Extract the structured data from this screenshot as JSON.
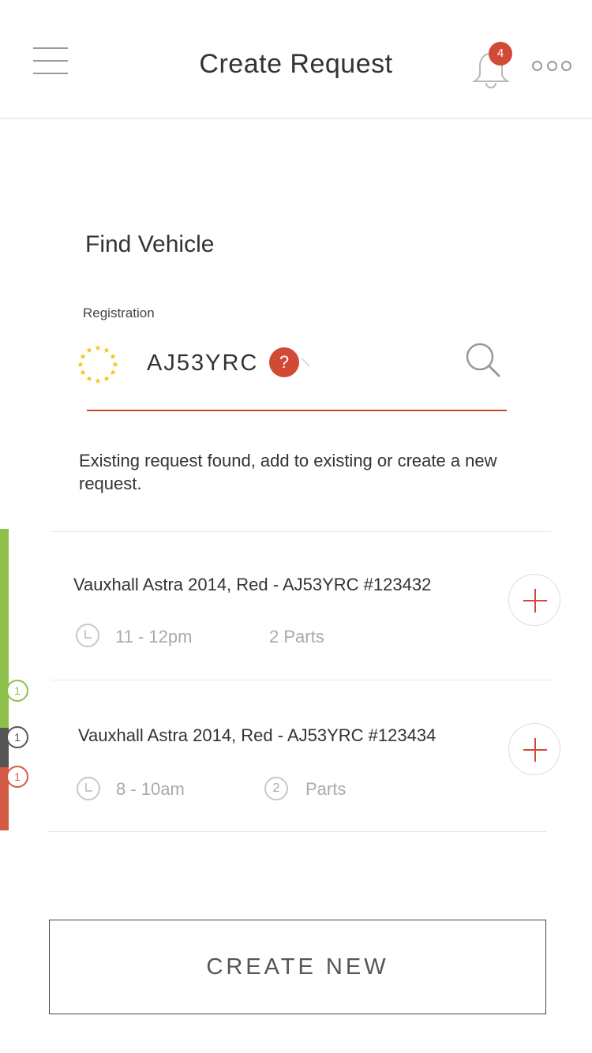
{
  "header": {
    "title": "Create Request",
    "notification_count": "4",
    "menu_icon": "hamburger-menu-icon",
    "bell_icon": "bell-icon",
    "more_icon": "more-dots-icon"
  },
  "find_vehicle": {
    "title": "Find Vehicle",
    "registration_label": "Registration",
    "registration_value": "AJ53YRC",
    "help_glyph": "?",
    "search_icon": "search-icon",
    "flag_icon": "eu-stars-icon",
    "info_text": "Existing request found, add to existing or create a new request."
  },
  "requests": [
    {
      "title": "Vauxhall Astra 2014, Red  - AJ53YRC  #123432",
      "time": "11 - 12pm",
      "parts": "2 Parts"
    },
    {
      "title": "Vauxhall Astra 2014, Red  - AJ53YRC  #123434",
      "time": "8 - 10am",
      "parts_count": "2",
      "parts_label": "Parts"
    }
  ],
  "side_markers": [
    {
      "count": "1",
      "color": "#8cc04b"
    },
    {
      "count": "1",
      "color": "#555555"
    },
    {
      "count": "1",
      "color": "#d35a45"
    }
  ],
  "colors": {
    "accent": "#d04a35",
    "green": "#8cc04b",
    "dark": "#555555",
    "red": "#d35a45"
  },
  "actions": {
    "create_new_label": "CREATE NEW"
  }
}
